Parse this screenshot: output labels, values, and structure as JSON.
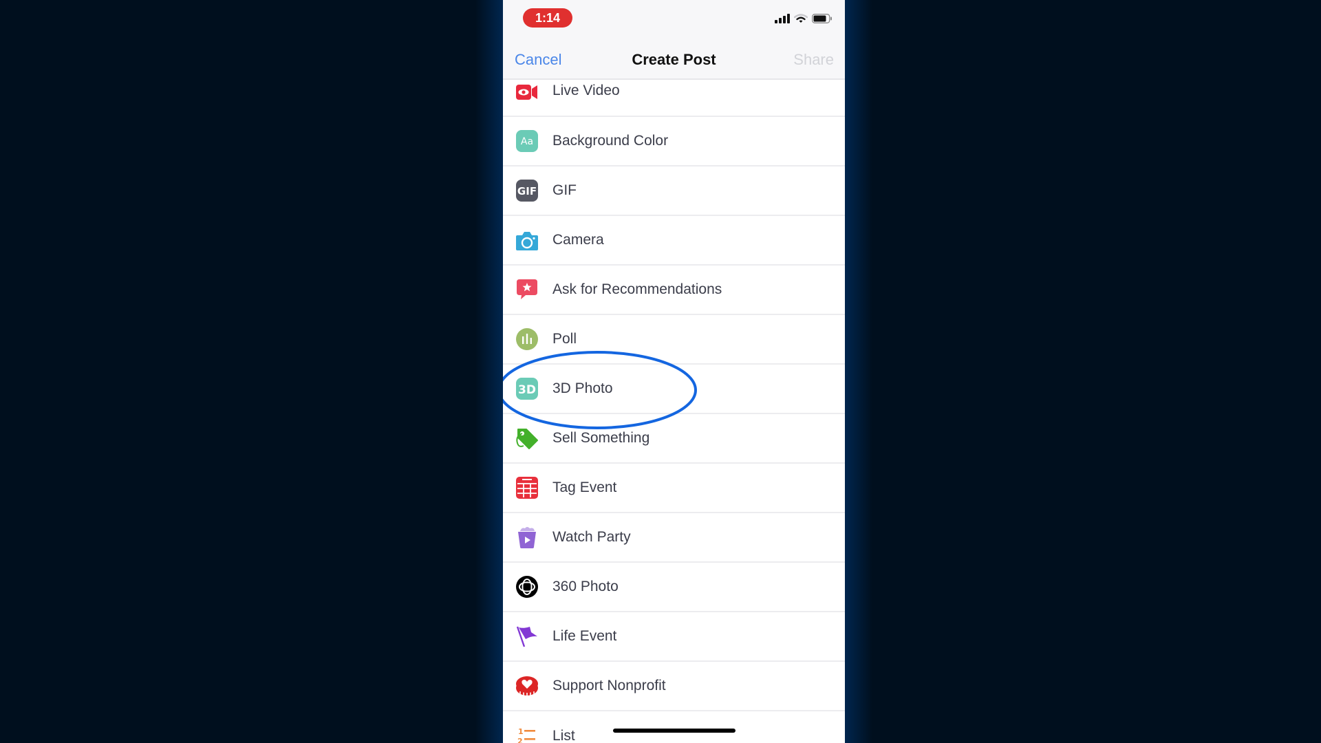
{
  "status_bar": {
    "time": "1:14",
    "signal_icon": "cellular-signal-icon",
    "wifi_icon": "wifi-icon",
    "battery_icon": "battery-icon"
  },
  "nav": {
    "cancel_label": "Cancel",
    "title": "Create Post",
    "share_label": "Share"
  },
  "menu": {
    "items": [
      {
        "label": "Live Video",
        "icon": "live-video-icon",
        "color": "#e8283c"
      },
      {
        "label": "Background Color",
        "icon": "background-color-icon",
        "color": "#6bcbb6"
      },
      {
        "label": "GIF",
        "icon": "gif-icon",
        "color": "#565863"
      },
      {
        "label": "Camera",
        "icon": "camera-icon",
        "color": "#35a8d8"
      },
      {
        "label": "Ask for Recommendations",
        "icon": "recommendations-icon",
        "color": "#ec4b62"
      },
      {
        "label": "Poll",
        "icon": "poll-icon",
        "color": "#9dbd68"
      },
      {
        "label": "3D Photo",
        "icon": "3d-photo-icon",
        "color": "#6bcbb6"
      },
      {
        "label": "Sell Something",
        "icon": "sell-tag-icon",
        "color": "#43b02a"
      },
      {
        "label": "Tag Event",
        "icon": "calendar-icon",
        "color": "#e8303c"
      },
      {
        "label": "Watch Party",
        "icon": "watch-party-icon",
        "color": "#9064d4"
      },
      {
        "label": "360 Photo",
        "icon": "360-photo-icon",
        "color": "#000000"
      },
      {
        "label": "Life Event",
        "icon": "flag-icon",
        "color": "#8238d4"
      },
      {
        "label": "Support Nonprofit",
        "icon": "nonprofit-heart-icon",
        "color": "#dc2626"
      },
      {
        "label": "List",
        "icon": "numbered-list-icon",
        "color": "#f08a3c"
      }
    ]
  },
  "annotation": {
    "highlight_color": "#1466e0",
    "highlighted_item": "3D Photo"
  }
}
